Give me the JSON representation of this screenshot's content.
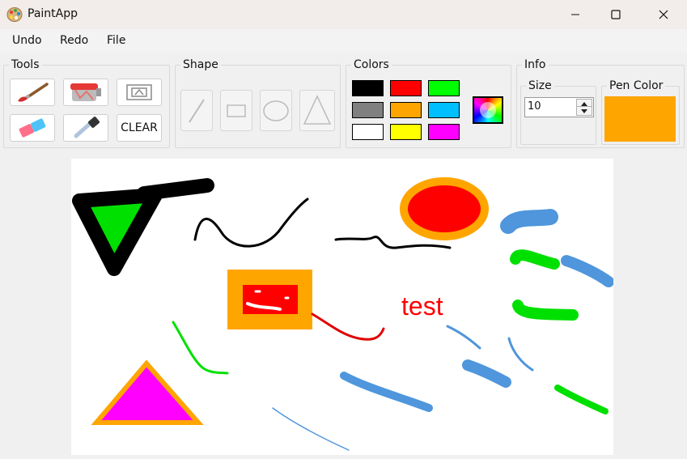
{
  "window": {
    "title": "PaintApp"
  },
  "menu": {
    "undo": "Undo",
    "redo": "Redo",
    "file": "File"
  },
  "tools": {
    "label": "Tools",
    "clear_label": "CLEAR"
  },
  "shape": {
    "label": "Shape"
  },
  "colors": {
    "label": "Colors",
    "palette": [
      "#000000",
      "#ff0000",
      "#00ff00",
      "#808080",
      "#ffa500",
      "#00bfff",
      "#ffffff",
      "#ffff00",
      "#ff00ff"
    ]
  },
  "info": {
    "label": "Info",
    "size_label": "Size",
    "size_value": "10",
    "pen_color_label": "Pen Color",
    "pen_color": "#ffa500"
  },
  "canvas": {
    "text": "test"
  }
}
